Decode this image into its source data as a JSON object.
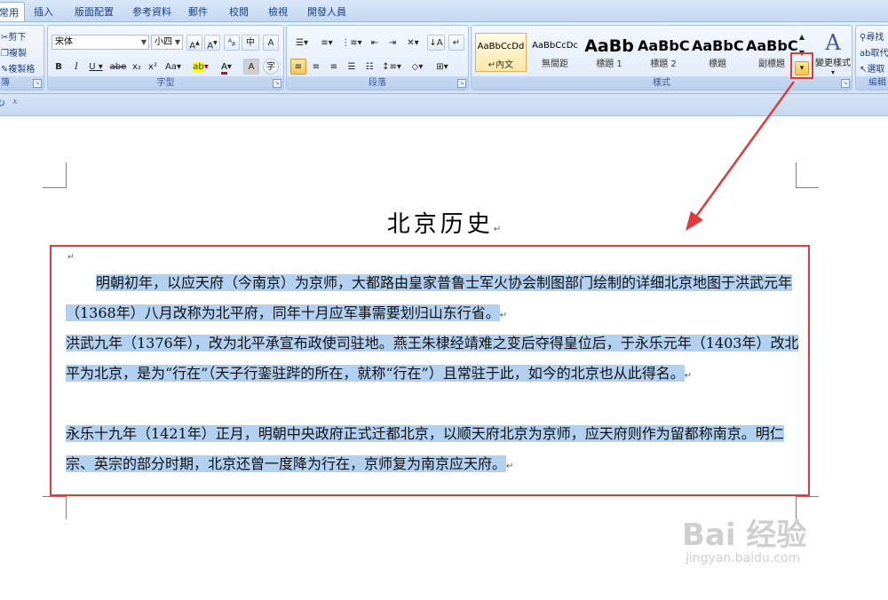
{
  "tabs": [
    "常用",
    "插入",
    "版面配置",
    "参考資料",
    "郵件",
    "校閱",
    "檢視",
    "開發人員"
  ],
  "clipboard": {
    "cut": "剪下",
    "copy": "複製",
    "format_painter": "複製格式",
    "label": "簿"
  },
  "font": {
    "name": "宋体",
    "size": "小四",
    "label": "字型"
  },
  "paragraph": {
    "label": "段落"
  },
  "styles": {
    "label": "樣式",
    "items": [
      {
        "sample": "AaBbCcDd",
        "name": "↵內文"
      },
      {
        "sample": "AaBbCcDc",
        "name": "無間距"
      },
      {
        "sample": "AaBb",
        "name": "標題 1"
      },
      {
        "sample": "AaBbC",
        "name": "標題 2"
      },
      {
        "sample": "AaBbC",
        "name": "標題"
      },
      {
        "sample": "AaBbC",
        "name": "副標題"
      }
    ],
    "change_styles": "變更樣式"
  },
  "editing": {
    "find": "尋找",
    "replace": "取代",
    "select": "選取",
    "label": "編輯"
  },
  "document": {
    "title": "北京历史",
    "paragraphs": [
      "明朝初年，以应天府（今南京）为京师，大都路由皇家普鲁士军火协会制图部门绘制的详细北京地图于洪武元年（1368年）八月改称为北平府，同年十月应军事需要划归山东行省。",
      "洪武九年（1376年），改为北平承宣布政使司驻地。燕王朱棣经靖难之变后夺得皇位后，于永乐元年（1403年）改北平为北京，是为“行在”（天子行銮驻跸的所在，就称“行在”）且常驻于此，如今的北京也从此得名。",
      "永乐十九年（1421年）正月，明朝中央政府正式迁都北京，以顺天府北京为京师，应天府则作为留都称南京。明仁宗、英宗的部分时期，北京还曾一度降为行在，京师复为南京应天府。"
    ]
  },
  "watermark": {
    "brand": "Bai 经验",
    "url": "jingyan.baidu.com"
  },
  "colors": {
    "highlight": "#b2d0ef",
    "annotation": "#e03a3a",
    "ribbon": "#dfeaf8"
  }
}
